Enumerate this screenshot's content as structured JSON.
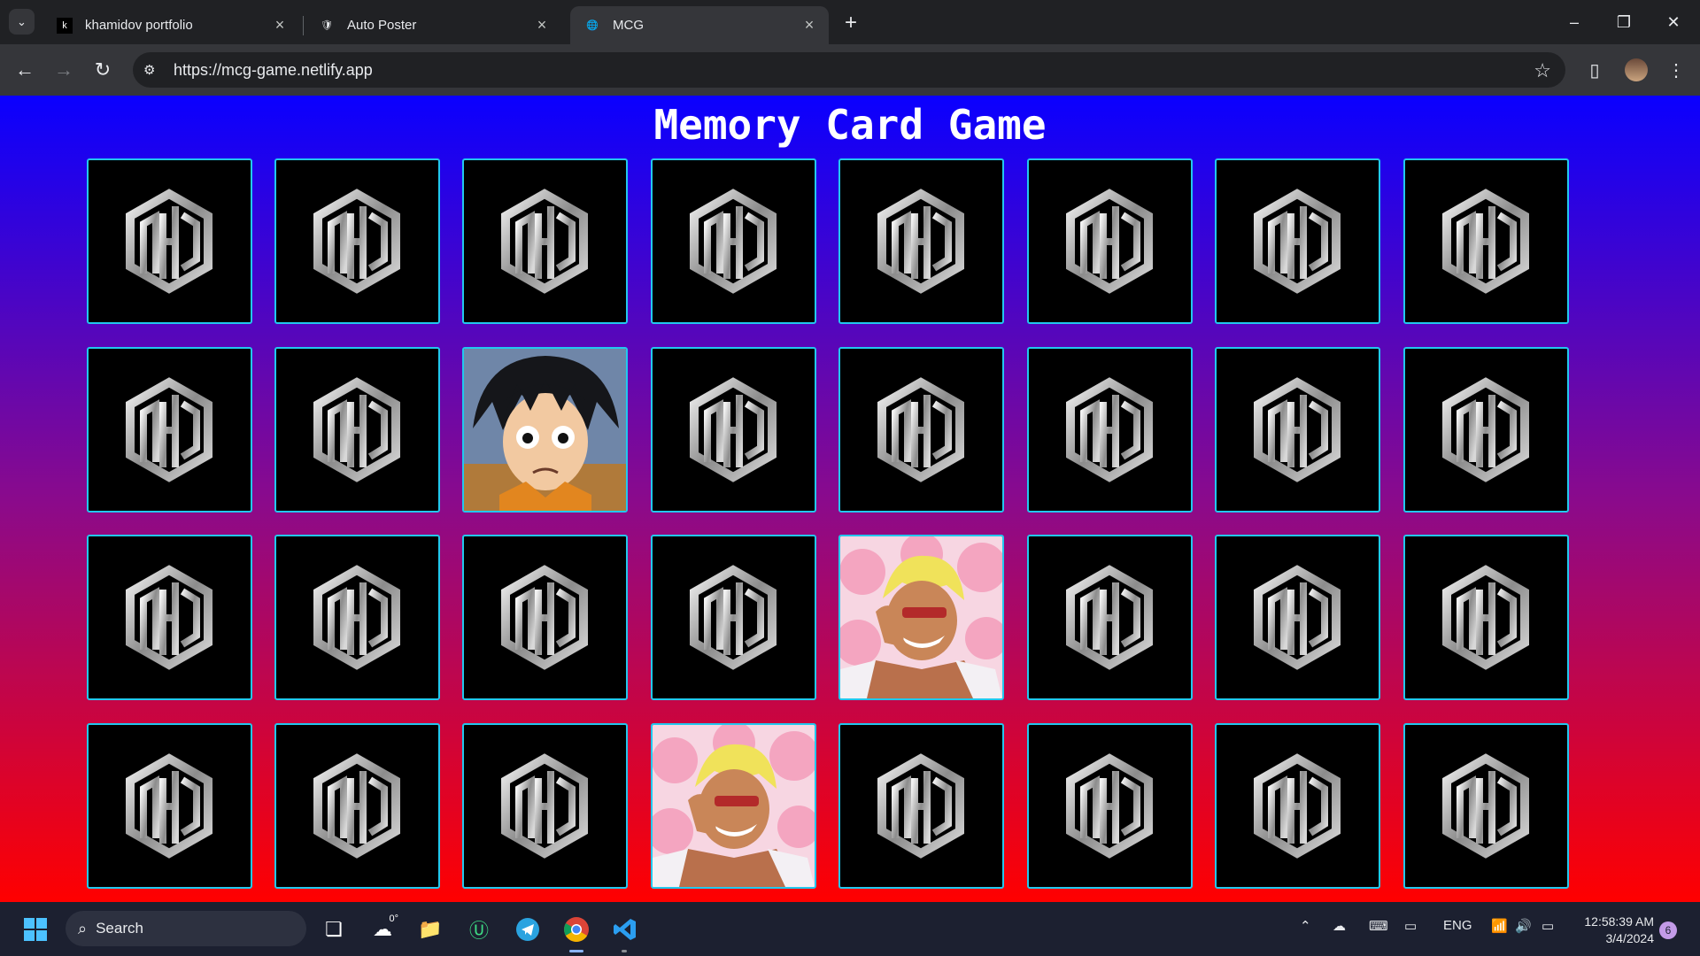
{
  "browser": {
    "tabs": [
      {
        "title": "khamidov portfolio",
        "active": false
      },
      {
        "title": "Auto Poster",
        "active": false
      },
      {
        "title": "MCG",
        "active": true
      }
    ],
    "address_url": "https://mcg-game.netlify.app"
  },
  "game": {
    "title": "Memory Card Game",
    "card_back_logo": "mcg-logo-icon",
    "rows": [
      [
        "back",
        "back",
        "back",
        "back",
        "back",
        "back",
        "back",
        "back"
      ],
      [
        "back",
        "back",
        "luffy",
        "back",
        "back",
        "back",
        "back",
        "back"
      ],
      [
        "back",
        "back",
        "back",
        "back",
        "doflamingo",
        "back",
        "back",
        "back"
      ],
      [
        "back",
        "back",
        "back",
        "doflamingo",
        "back",
        "back",
        "back",
        "back"
      ]
    ]
  },
  "taskbar": {
    "search_label": "Search",
    "weather_temp": "0°",
    "language": "ENG",
    "time": "12:58:39 AM",
    "date": "3/4/2024",
    "notification_count": "6"
  },
  "colors": {
    "gradient_top": "#0a00ff",
    "gradient_bottom": "#ff0000",
    "card_border": "#22c8ee",
    "card_back": "#000000"
  }
}
